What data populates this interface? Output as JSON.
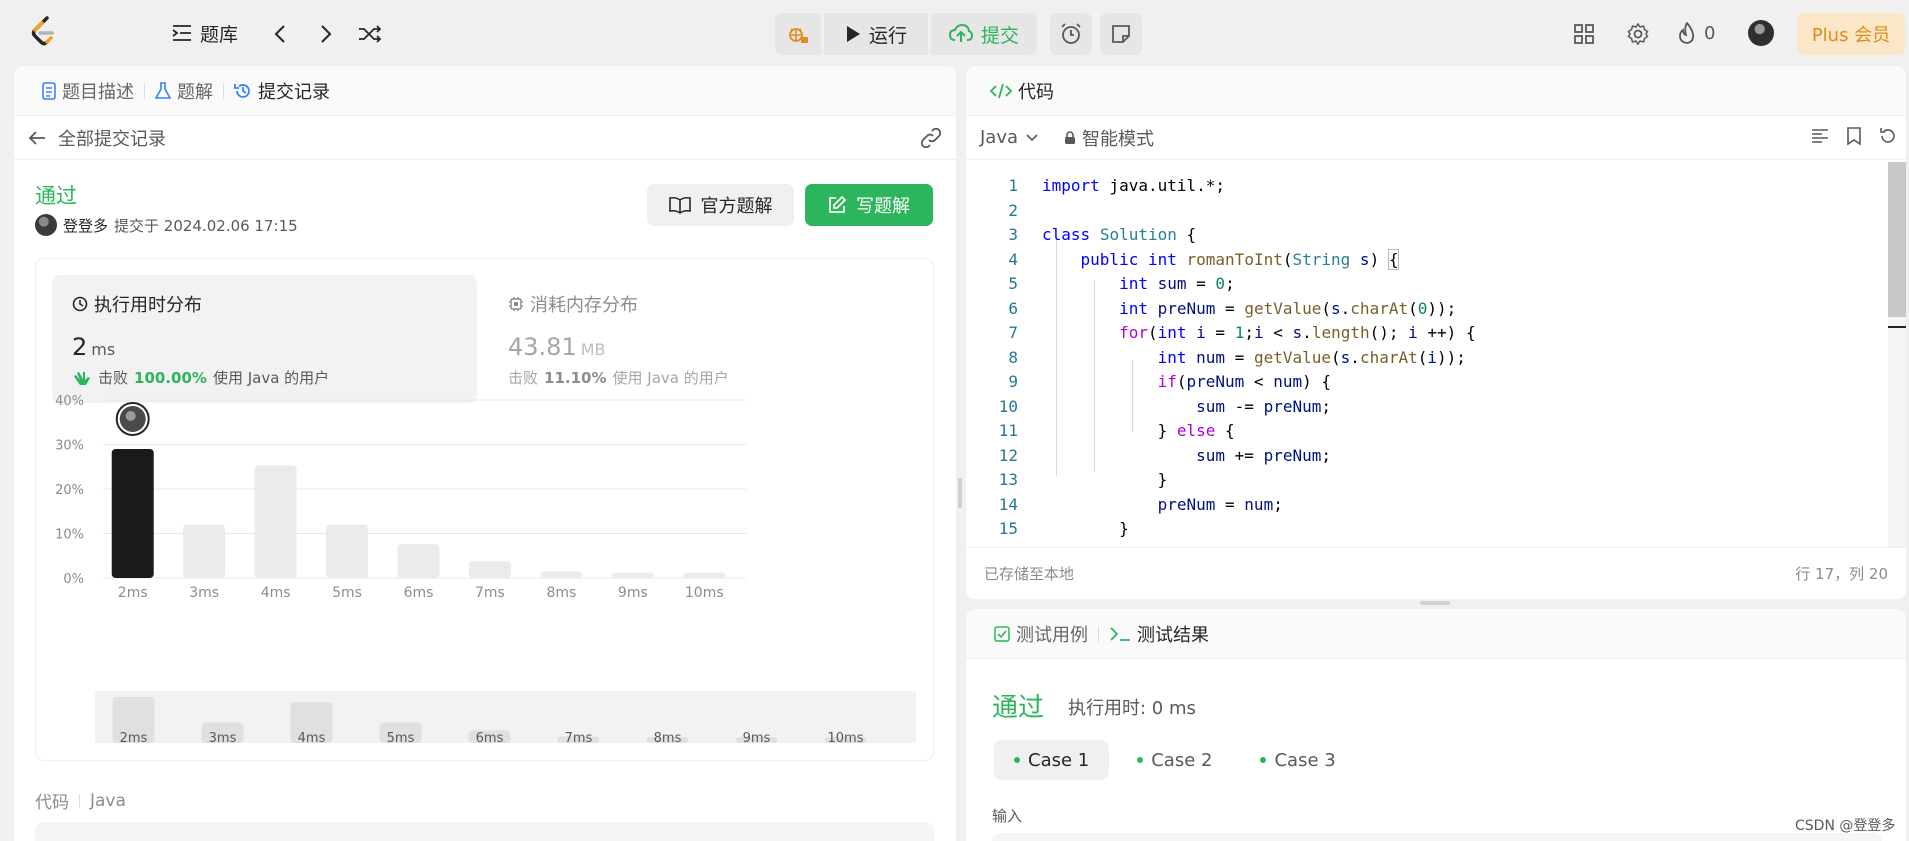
{
  "topbar": {
    "problems_label": "题库",
    "run_label": "运行",
    "submit_label": "提交",
    "fire_count": "0",
    "plus_label": "Plus 会员"
  },
  "left": {
    "tabs": [
      "题目描述",
      "题解",
      "提交记录"
    ],
    "back_label": "全部提交记录",
    "status": "通过",
    "author": "登登多",
    "submitted_at": "提交于 2024.02.06 17:15",
    "official_solution": "官方题解",
    "write_solution": "写题解",
    "runtime": {
      "title": "执行用时分布",
      "value": "2",
      "unit": "ms",
      "beat_prefix": "击败",
      "beat_pct": "100.00%",
      "beat_suffix": "使用 Java 的用户"
    },
    "memory": {
      "title": "消耗内存分布",
      "value": "43.81",
      "unit": "MB",
      "beat_prefix": "击败",
      "beat_pct": "11.10%",
      "beat_suffix": "使用 Java 的用户"
    },
    "code_label": "代码",
    "code_lang": "Java"
  },
  "chart_data": {
    "type": "bar",
    "categories": [
      "2ms",
      "3ms",
      "4ms",
      "5ms",
      "6ms",
      "7ms",
      "8ms",
      "9ms",
      "10ms"
    ],
    "values": [
      29,
      12,
      25.3,
      12,
      7.6,
      3.8,
      1.5,
      1.2,
      1.2
    ],
    "y_ticks": [
      "0%",
      "10%",
      "20%",
      "30%",
      "40%"
    ],
    "ylim": [
      0,
      40
    ],
    "highlight_index": 0,
    "highlight_color": "#1a1a1a",
    "bar_color": "#ebebeb",
    "overview_values": [
      9,
      4,
      8,
      4,
      2.5,
      1.3,
      0.6,
      0.5,
      0.5
    ],
    "grid": true
  },
  "editor": {
    "tab_label": "代码",
    "language": "Java",
    "mode": "智能模式",
    "saved_status": "已存储至本地",
    "cursor_position": "行 17，列 20",
    "line_numbers": [
      "1",
      "2",
      "3",
      "4",
      "5",
      "6",
      "7",
      "8",
      "9",
      "10",
      "11",
      "12",
      "13",
      "14",
      "15"
    ]
  },
  "result": {
    "tabs": [
      "测试用例",
      "测试结果"
    ],
    "status": "通过",
    "runtime": "执行用时: 0 ms",
    "cases": [
      "Case 1",
      "Case 2",
      "Case 3"
    ],
    "input_label": "输入"
  },
  "watermark": "CSDN @登登多"
}
